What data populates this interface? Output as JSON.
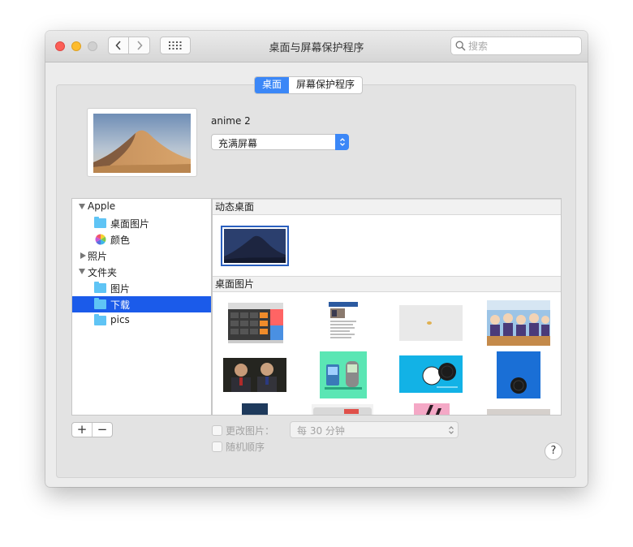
{
  "window": {
    "title": "桌面与屏幕保护程序"
  },
  "search": {
    "placeholder": "搜索"
  },
  "tabs": [
    {
      "label": "桌面",
      "active": true
    },
    {
      "label": "屏幕保护程序",
      "active": false
    }
  ],
  "current_image": {
    "name": "anime 2",
    "fit_option": "充满屏幕"
  },
  "sidebar": {
    "apple": {
      "label": "Apple",
      "children": [
        {
          "label": "桌面图片"
        },
        {
          "label": "颜色"
        }
      ]
    },
    "photos": {
      "label": "照片"
    },
    "folders": {
      "label": "文件夹",
      "children": [
        {
          "label": "图片"
        },
        {
          "label": "下载",
          "selected": true
        },
        {
          "label": "pics"
        }
      ]
    }
  },
  "browser": {
    "section_dynamic": "动态桌面",
    "section_pictures": "桌面图片"
  },
  "footer": {
    "add": "+",
    "remove": "−",
    "change_picture": "更改图片：",
    "interval": "每 30 分钟",
    "random_order": "随机顺序",
    "help": "?"
  },
  "colors": {
    "accent": "#3b87f7",
    "selection": "#1b5bea",
    "folder": "#5fc4f5"
  }
}
